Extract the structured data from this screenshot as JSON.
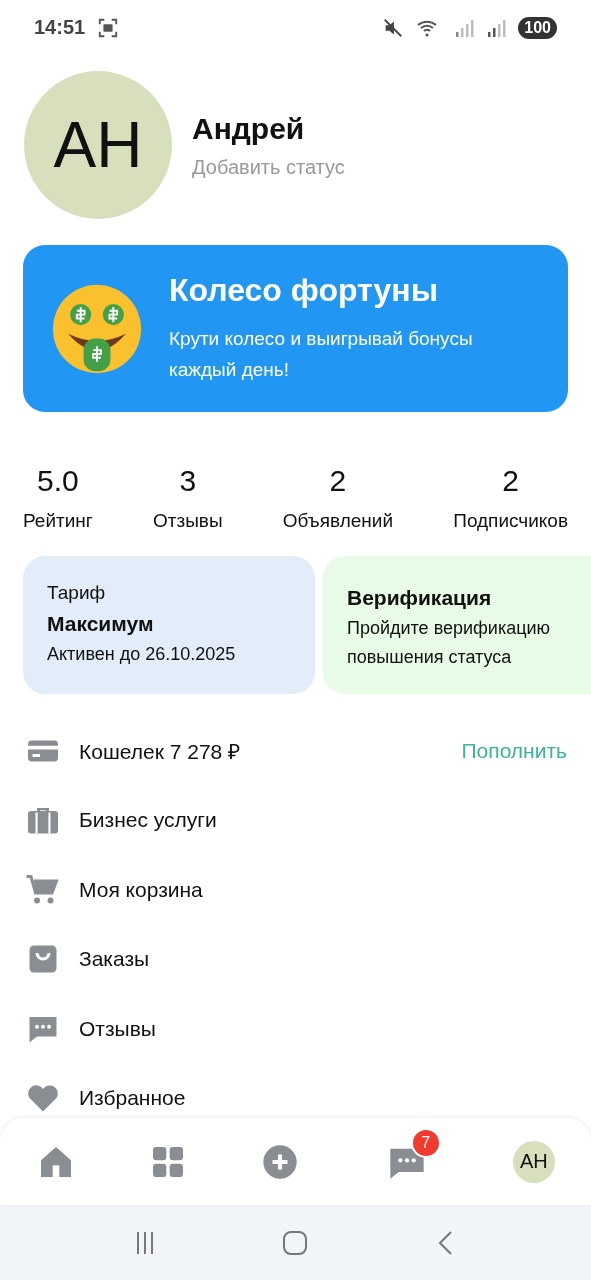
{
  "status_bar": {
    "time": "14:51",
    "battery": "100"
  },
  "profile": {
    "initials": "АН",
    "name": "Андрей",
    "status_placeholder": "Добавить статус"
  },
  "promo": {
    "title": "Колесо фортуны",
    "text": "Крути колесо и выигрывай бонусы каждый день!"
  },
  "stats": [
    {
      "value": "5.0",
      "label": "Рейтинг"
    },
    {
      "value": "3",
      "label": "Отзывы"
    },
    {
      "value": "2",
      "label": "Объявлений"
    },
    {
      "value": "2",
      "label": "Подписчиков"
    }
  ],
  "cards": [
    {
      "kind": "tariff",
      "caption": "Тариф",
      "title": "Максимум",
      "lines": [
        "Активен до 26.10.2025"
      ]
    },
    {
      "kind": "verification",
      "title": "Верификация",
      "lines": [
        "Пройдите верификацию",
        "повышения статуса"
      ]
    }
  ],
  "menu": [
    {
      "kind": "card",
      "label": "Кошелек 7 278 ₽",
      "action": "Пополнить"
    },
    {
      "kind": "briefcase",
      "label": "Бизнес услуги"
    },
    {
      "kind": "cart",
      "label": "Моя корзина"
    },
    {
      "kind": "bag",
      "label": "Заказы"
    },
    {
      "kind": "chat",
      "label": "Отзывы"
    },
    {
      "kind": "heart",
      "label": "Избранное"
    }
  ],
  "bottom_nav": [
    {
      "kind": "home"
    },
    {
      "kind": "grid"
    },
    {
      "kind": "plus"
    },
    {
      "kind": "messages",
      "badge": "7"
    },
    {
      "kind": "avatar",
      "initials": "АН"
    }
  ]
}
